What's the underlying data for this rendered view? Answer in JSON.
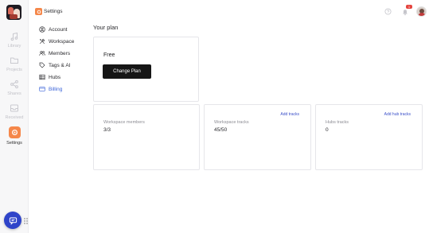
{
  "rail": {
    "items": [
      {
        "label": "Library",
        "icon": "music-note-icon"
      },
      {
        "label": "Projects",
        "icon": "folder-icon"
      },
      {
        "label": "Shares",
        "icon": "share-icon"
      },
      {
        "label": "Received",
        "icon": "inbox-icon"
      },
      {
        "label": "Settings",
        "icon": "gear-icon"
      }
    ]
  },
  "topbar": {
    "title": "Settings",
    "notification_count": "1"
  },
  "nav": {
    "items": [
      {
        "label": "Account",
        "icon": "user-circle-icon"
      },
      {
        "label": "Workspace",
        "icon": "tools-icon"
      },
      {
        "label": "Members",
        "icon": "users-icon"
      },
      {
        "label": "Tags & AI",
        "icon": "tag-icon"
      },
      {
        "label": "Hubs",
        "icon": "hub-icon"
      },
      {
        "label": "Billing",
        "icon": "credit-card-icon"
      }
    ],
    "active": "Billing"
  },
  "main": {
    "title": "Your plan",
    "plan": {
      "name": "Free",
      "button": "Change Plan"
    },
    "cards": [
      {
        "label": "Workspace members",
        "value": "3/3",
        "link": ""
      },
      {
        "label": "Workspace tracks",
        "value": "45/50",
        "link": "Add tracks"
      },
      {
        "label": "Hubs tracks",
        "value": "0",
        "link": "Add hub tracks"
      }
    ]
  },
  "colors": {
    "accent": "#f5874a",
    "active_nav": "#3a63d8",
    "link": "#3a4fc9",
    "chat_button": "#2f44c9",
    "badge": "#e5453f"
  }
}
